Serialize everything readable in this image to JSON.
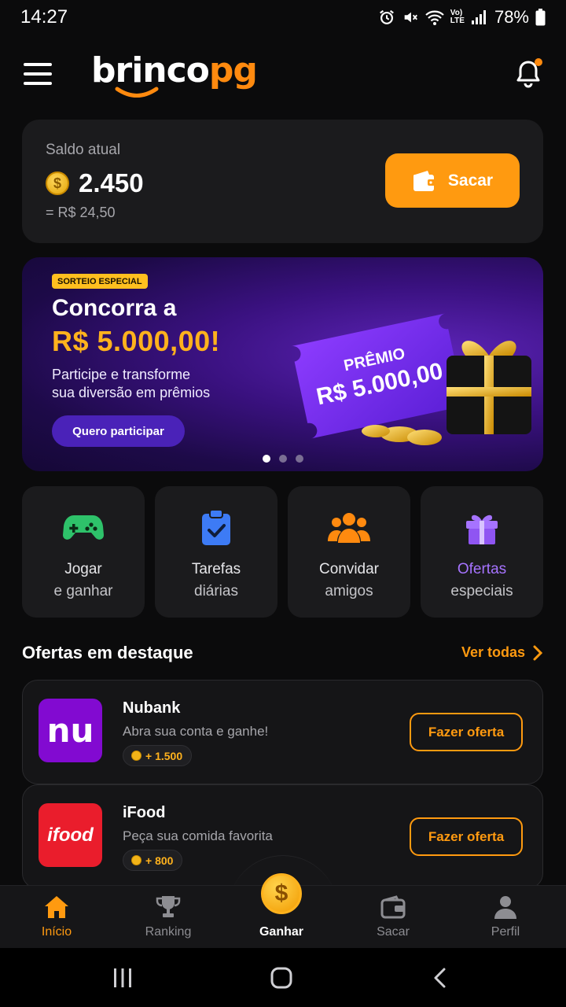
{
  "status_bar": {
    "time": "14:27",
    "battery": "78%"
  },
  "header": {
    "logo_part1": "brinco",
    "logo_part2": "pg"
  },
  "balance": {
    "label": "Saldo atual",
    "value": "2.450",
    "brl": "= R$ 24,50",
    "button_label": "Sacar"
  },
  "banner": {
    "tag": "SORTEIO ESPECIAL",
    "title": "Concorra a",
    "amount": "R$ 5.000,00!",
    "subtitle_line1": "Participe e transforme",
    "subtitle_line2": "sua diversão em prêmios",
    "cta": "Quero participar",
    "ticket_title": "PRÊMIO",
    "ticket_amount": "R$ 5.000,00",
    "slides": 3,
    "active_slide": 1
  },
  "actions": [
    {
      "line1": "Jogar",
      "line2": "e ganhar",
      "icon": "gamepad-icon",
      "color": "#2ec26a"
    },
    {
      "line1": "Tarefas",
      "line2": "diárias",
      "icon": "clipboard-check-icon",
      "color": "#3d7bf5"
    },
    {
      "line1": "Convidar",
      "line2": "amigos",
      "icon": "users-icon",
      "color": "#ff8a0f"
    },
    {
      "line1": "Ofertas",
      "line2": "especiais",
      "icon": "gift-icon",
      "color": "#a673ff"
    }
  ],
  "offers_section": {
    "title": "Ofertas em destaque",
    "see_all": "Ver todas"
  },
  "offers": [
    {
      "name": "Nubank",
      "description": "Abra sua conta e ganhe!",
      "reward": "+ 1.500",
      "button": "Fazer oferta",
      "logo_text": "nu",
      "logo_color": "#820ad1"
    },
    {
      "name": "iFood",
      "description": "Peça sua comida favorita",
      "reward": "+ 800",
      "button": "Fazer oferta",
      "logo_text": "ifood",
      "logo_color": "#ea1d2c"
    }
  ],
  "bottom_nav": [
    {
      "label": "Início",
      "icon": "home-icon",
      "active": true
    },
    {
      "label": "Ranking",
      "icon": "trophy-icon"
    },
    {
      "label": "Ganhar",
      "icon": "dollar-coin-icon"
    },
    {
      "label": "Sacar",
      "icon": "wallet-icon"
    },
    {
      "label": "Perfil",
      "icon": "user-icon"
    }
  ],
  "colors": {
    "accent": "#ff9a10",
    "background": "#0b0b0c",
    "card": "#1b1b1d",
    "banner_purple": "#3a1180"
  }
}
